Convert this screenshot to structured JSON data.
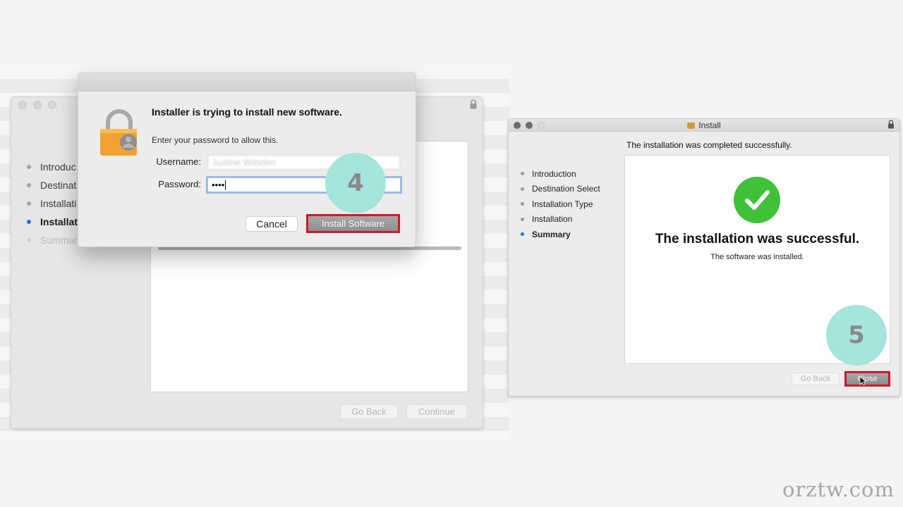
{
  "left_window": {
    "steps": [
      {
        "label": "Introduc",
        "state": "done"
      },
      {
        "label": "Destinat",
        "state": "done"
      },
      {
        "label": "Installati",
        "state": "done"
      },
      {
        "label": "Installat",
        "state": "active"
      },
      {
        "label": "Summar",
        "state": "pending"
      }
    ],
    "go_back_label": "Go Back",
    "continue_label": "Continue"
  },
  "auth_dialog": {
    "title": "Installer is trying to install new software.",
    "message": "Enter your password to allow this.",
    "username_label": "Username:",
    "username_value": "Justine Wilsden",
    "password_label": "Password:",
    "password_value": "••••",
    "cancel_label": "Cancel",
    "install_label": "Install Software"
  },
  "badges": {
    "step4": "4",
    "step5": "5",
    "badge_color": "#a6e4de"
  },
  "right_window": {
    "title": "Install",
    "header": "The installation was completed successfully.",
    "steps": [
      {
        "label": "Introduction",
        "state": "done"
      },
      {
        "label": "Destination Select",
        "state": "done"
      },
      {
        "label": "Installation Type",
        "state": "done"
      },
      {
        "label": "Installation",
        "state": "done"
      },
      {
        "label": "Summary",
        "state": "active"
      }
    ],
    "success_title": "The installation was successful.",
    "success_subtitle": "The software was installed.",
    "go_back_label": "Go Back",
    "close_label": "Close",
    "success_color": "#3fc13a"
  },
  "highlight_color": "#cc1a2a",
  "watermark": "orztw.com"
}
